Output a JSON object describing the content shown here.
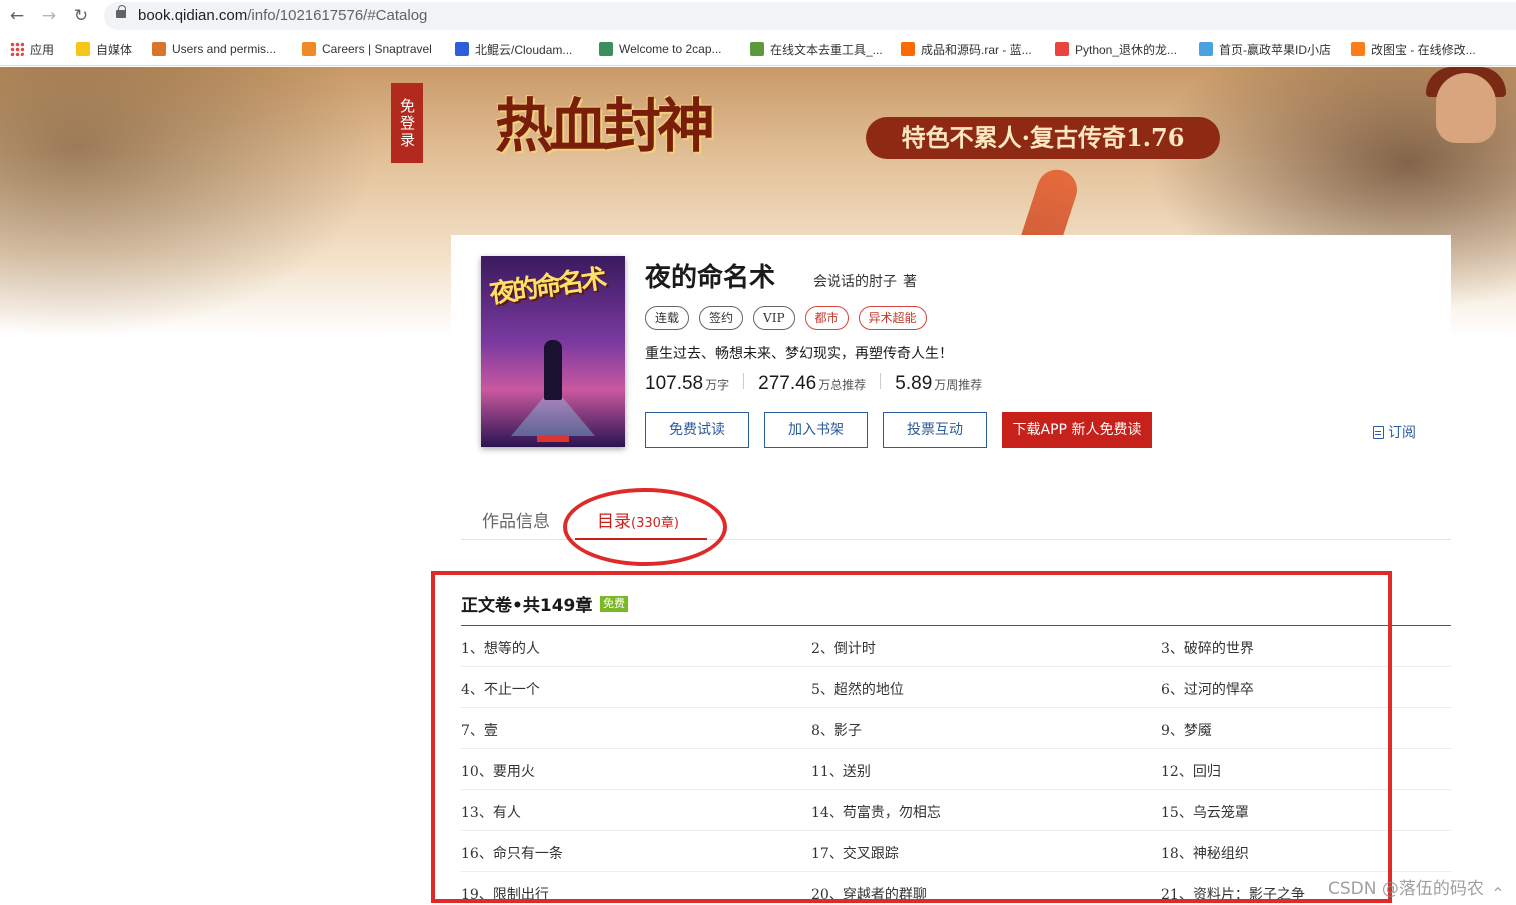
{
  "browser": {
    "url_host": "book.qidian.com",
    "url_path": "/info/1021617576/#Catalog",
    "bookmarks": [
      {
        "label": "应用",
        "color": "#e8453c"
      },
      {
        "label": "自媒体",
        "color": "#f5c518"
      },
      {
        "label": "Users and permis...",
        "color": "#d8742b"
      },
      {
        "label": "Careers | Snaptravel",
        "color": "#f08a24"
      },
      {
        "label": "北鲲云/Cloudam...",
        "color": "#2b5fd9"
      },
      {
        "label": "Welcome to 2cap...",
        "color": "#3a8f5c"
      },
      {
        "label": "在线文本去重工具_...",
        "color": "#5a9a3a"
      },
      {
        "label": "成品和源码.rar - 蓝...",
        "color": "#ff6a00"
      },
      {
        "label": "Python_退休的龙...",
        "color": "#e8453c"
      },
      {
        "label": "首页-赢政苹果ID小店",
        "color": "#4aa3df"
      },
      {
        "label": "改图宝 - 在线修改...",
        "color": "#ff7a1a"
      }
    ]
  },
  "banner": {
    "free_login": "免登录",
    "game_title": "热血封神",
    "slogan": "特色不累人·复古传奇1.76"
  },
  "book": {
    "title": "夜的命名术",
    "cover_text": "夜的命名术",
    "author": "会说话的肘子",
    "author_suffix": "著",
    "tags": [
      {
        "label": "连载",
        "style": "normal"
      },
      {
        "label": "签约",
        "style": "normal"
      },
      {
        "label": "VIP",
        "style": "normal"
      },
      {
        "label": "都市",
        "style": "red"
      },
      {
        "label": "异术超能",
        "style": "red"
      }
    ],
    "intro": "重生过去、畅想未来、梦幻现实，再塑传奇人生！",
    "stats": [
      {
        "num": "107.58",
        "unit": "万字"
      },
      {
        "num": "277.46",
        "unit": "万总推荐"
      },
      {
        "num": "5.89",
        "unit": "万周推荐"
      }
    ],
    "buttons": {
      "free_read": "免费试读",
      "add_shelf": "加入书架",
      "vote": "投票互动",
      "download": "下载APP 新人免费读"
    },
    "subscribe": "订阅"
  },
  "tabs": {
    "info": "作品信息",
    "catalog": "目录",
    "catalog_count": "(330章)"
  },
  "catalog": {
    "volume_title": "正文卷•共149章",
    "free_badge": "免费",
    "chapters": [
      "1、想等的人",
      "2、倒计时",
      "3、破碎的世界",
      "4、不止一个",
      "5、超然的地位",
      "6、过河的悍卒",
      "7、壹",
      "8、影子",
      "9、梦魇",
      "10、要用火",
      "11、送别",
      "12、回归",
      "13、有人",
      "14、苟富贵，勿相忘",
      "15、乌云笼罩",
      "16、命只有一条",
      "17、交叉跟踪",
      "18、神秘组织",
      "19、限制出行",
      "20、穿越者的群聊",
      "21、资料片：影子之争"
    ]
  },
  "watermark": "CSDN @落伍的码农"
}
